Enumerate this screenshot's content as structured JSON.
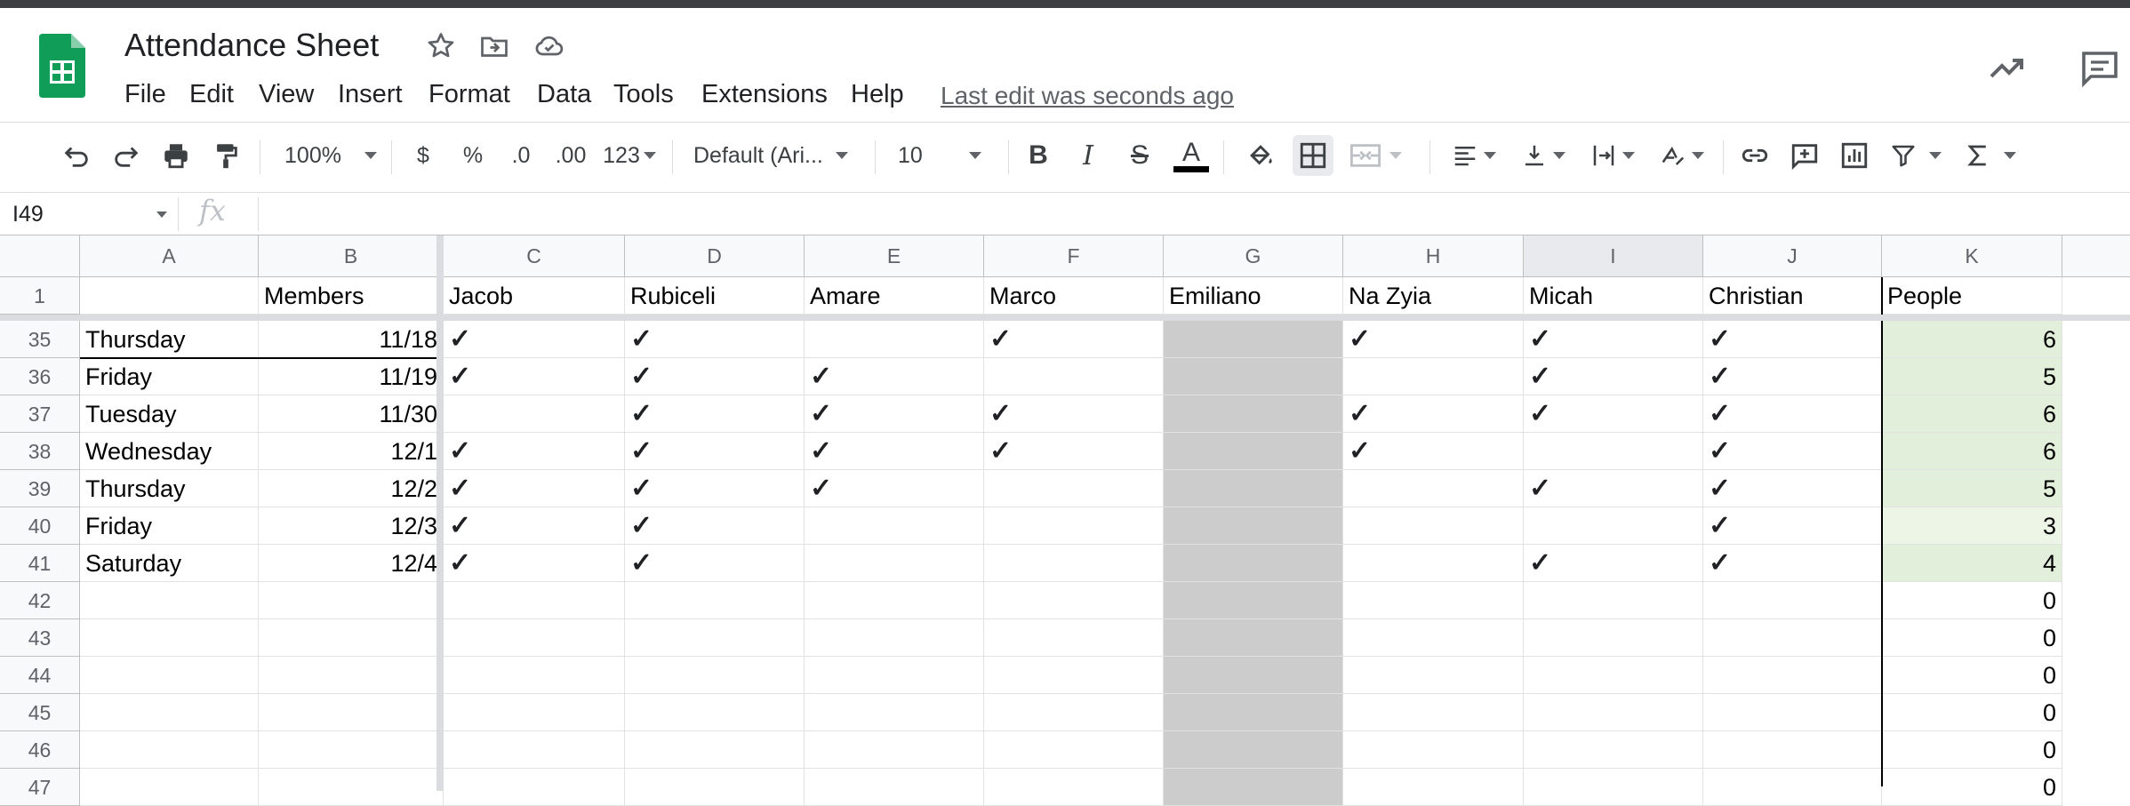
{
  "header": {
    "title": "Attendance Sheet",
    "last_edit": "Last edit was seconds ago",
    "menu": [
      "File",
      "Edit",
      "View",
      "Insert",
      "Format",
      "Data",
      "Tools",
      "Extensions",
      "Help"
    ]
  },
  "toolbar": {
    "zoom": "100%",
    "currency": "$",
    "percent": "%",
    "dec_decrease": ".0",
    "dec_increase": ".00",
    "more_formats": "123",
    "font": "Default (Ari...",
    "font_size": "10",
    "bold": "B",
    "italic": "I",
    "strike": "S",
    "text_color": "A",
    "text_color_swatch": "#000000"
  },
  "formula_bar": {
    "cell_ref": "I49",
    "fx": "fx",
    "value": ""
  },
  "grid": {
    "columns": [
      "A",
      "B",
      "C",
      "D",
      "E",
      "F",
      "G",
      "H",
      "I",
      "J",
      "K"
    ],
    "selected_column": "I",
    "header_row": {
      "row_number": "1",
      "cells": [
        "",
        "Members",
        "Jacob",
        "Rubiceli",
        "Amare",
        "Marco",
        "Emiliano",
        "Na Zyia",
        "Micah",
        "Christian",
        "People"
      ]
    },
    "rows": [
      {
        "num": "35",
        "day": "Thursday",
        "date": "11/18",
        "checks": [
          "✓",
          "✓",
          "",
          "✓",
          "",
          "✓",
          "✓",
          "✓"
        ],
        "people": "6"
      },
      {
        "num": "36",
        "day": "Friday",
        "date": "11/19",
        "checks": [
          "✓",
          "✓",
          "✓",
          "",
          "",
          "",
          "✓",
          "✓"
        ],
        "people": "5"
      },
      {
        "num": "37",
        "day": "Tuesday",
        "date": "11/30",
        "checks": [
          "",
          "✓",
          "✓",
          "✓",
          "",
          "✓",
          "✓",
          "✓"
        ],
        "people": "6"
      },
      {
        "num": "38",
        "day": "Wednesday",
        "date": "12/1",
        "checks": [
          "✓",
          "✓",
          "✓",
          "✓",
          "",
          "✓",
          "",
          "✓"
        ],
        "people": "6"
      },
      {
        "num": "39",
        "day": "Thursday",
        "date": "12/2",
        "checks": [
          "✓",
          "✓",
          "✓",
          "",
          "",
          "",
          "✓",
          "✓"
        ],
        "people": "5"
      },
      {
        "num": "40",
        "day": "Friday",
        "date": "12/3",
        "checks": [
          "✓",
          "✓",
          "",
          "",
          "",
          "",
          "",
          "✓"
        ],
        "people": "3"
      },
      {
        "num": "41",
        "day": "Saturday",
        "date": "12/4",
        "checks": [
          "✓",
          "✓",
          "",
          "",
          "",
          "",
          "✓",
          "✓"
        ],
        "people": "4"
      },
      {
        "num": "42",
        "day": "",
        "date": "",
        "checks": [
          "",
          "",
          "",
          "",
          "",
          "",
          "",
          ""
        ],
        "people": "0"
      },
      {
        "num": "43",
        "day": "",
        "date": "",
        "checks": [
          "",
          "",
          "",
          "",
          "",
          "",
          "",
          ""
        ],
        "people": "0"
      },
      {
        "num": "44",
        "day": "",
        "date": "",
        "checks": [
          "",
          "",
          "",
          "",
          "",
          "",
          "",
          ""
        ],
        "people": "0"
      },
      {
        "num": "45",
        "day": "",
        "date": "",
        "checks": [
          "",
          "",
          "",
          "",
          "",
          "",
          "",
          ""
        ],
        "people": "0"
      },
      {
        "num": "46",
        "day": "",
        "date": "",
        "checks": [
          "",
          "",
          "",
          "",
          "",
          "",
          "",
          ""
        ],
        "people": "0"
      },
      {
        "num": "47",
        "day": "",
        "date": "",
        "checks": [
          "",
          "",
          "",
          "",
          "",
          "",
          "",
          ""
        ],
        "people": "0"
      }
    ]
  },
  "colors": {
    "sheets_green": "#0f9d58",
    "grey_column": "#cccccc",
    "people_highlight": "#e2efda"
  }
}
